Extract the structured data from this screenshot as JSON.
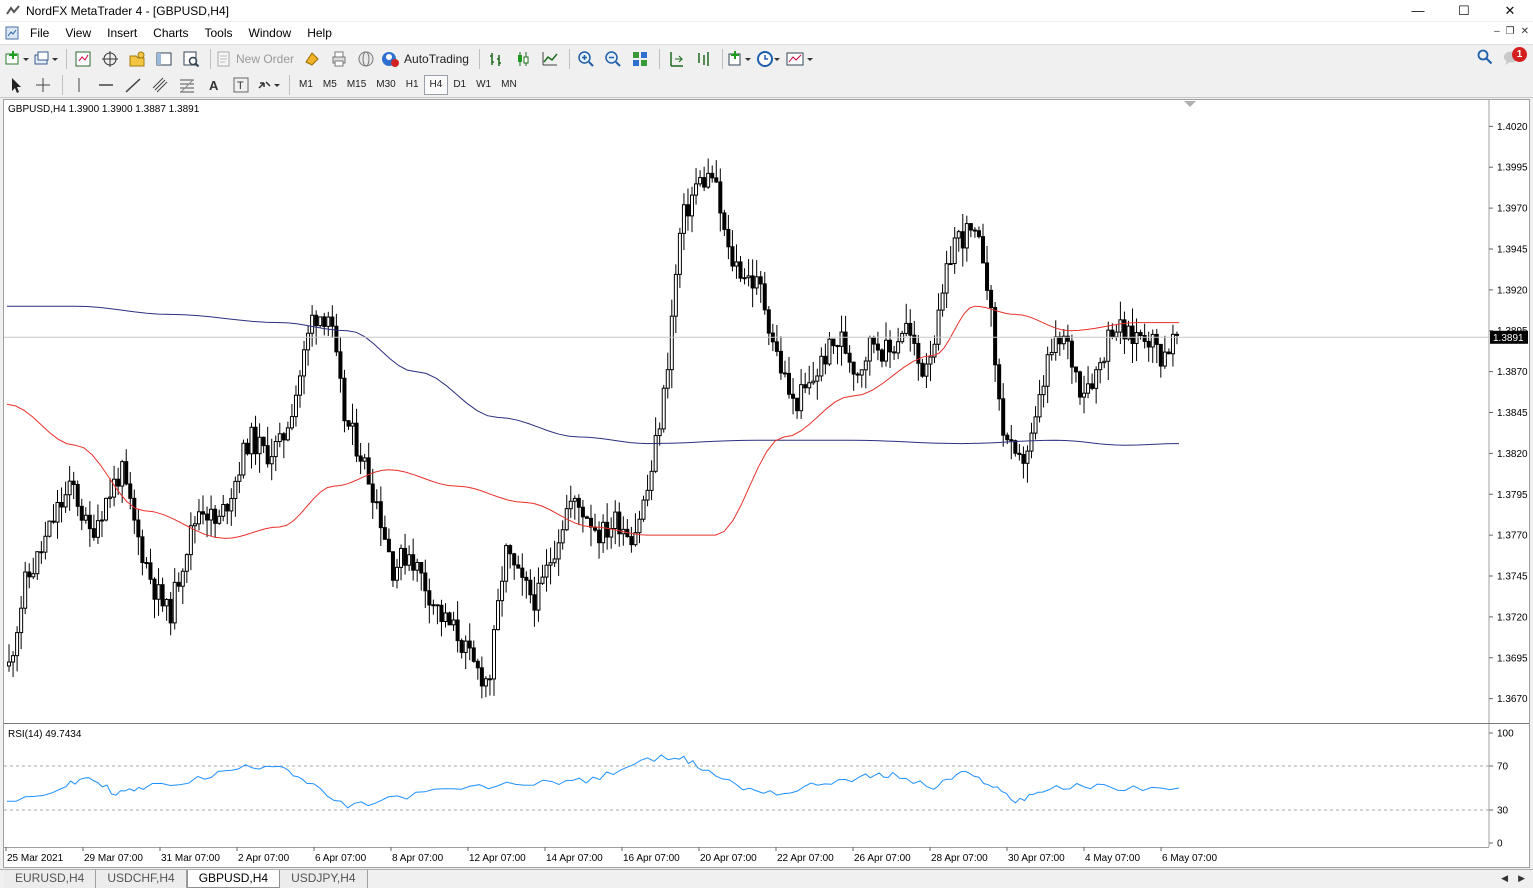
{
  "window": {
    "title": "NordFX MetaTrader 4 - [GBPUSD,H4]",
    "minimize": "—",
    "maximize": "☐",
    "close": "✕"
  },
  "menu": [
    "File",
    "View",
    "Insert",
    "Charts",
    "Tools",
    "Window",
    "Help"
  ],
  "mdi": {
    "minimize": "–",
    "restore": "❐",
    "close": "✕"
  },
  "toolbar": {
    "new_order": "New Order",
    "autotrading": "AutoTrading",
    "notification_count": "1"
  },
  "timeframes": [
    "M1",
    "M5",
    "M15",
    "M30",
    "H1",
    "H4",
    "D1",
    "W1",
    "MN"
  ],
  "active_timeframe": "H4",
  "chart": {
    "header": "GBPUSD,H4  1.3900 1.3900 1.3887 1.3891",
    "current_price": "1.3891",
    "rsi_label": "RSI(14) 49.7434",
    "colors": {
      "ma_fast": "#e8302a",
      "ma_slow": "#2b2f7e",
      "rsi": "#1e90ff",
      "candles": "#000000",
      "price_label_bg": "#000000"
    }
  },
  "chart_data": {
    "type": "candlestick",
    "symbol": "GBPUSD",
    "timeframe": "H4",
    "price_axis": {
      "ticks": [
        "1.4020",
        "1.3995",
        "1.3970",
        "1.3945",
        "1.3920",
        "1.3895",
        "1.3870",
        "1.3845",
        "1.3820",
        "1.3795",
        "1.3770",
        "1.3745",
        "1.3720",
        "1.3695",
        "1.3670"
      ],
      "ylim": [
        1.366,
        1.403
      ]
    },
    "rsi_axis": {
      "ticks": [
        "100",
        "70",
        "30",
        "0"
      ],
      "levels": [
        70,
        30
      ],
      "ylim": [
        0,
        100
      ]
    },
    "time_axis": [
      "25 Mar 2021",
      "29 Mar 07:00",
      "31 Mar 07:00",
      "2 Apr 07:00",
      "6 Apr 07:00",
      "8 Apr 07:00",
      "12 Apr 07:00",
      "14 Apr 07:00",
      "16 Apr 07:00",
      "20 Apr 07:00",
      "22 Apr 07:00",
      "26 Apr 07:00",
      "28 Apr 07:00",
      "30 Apr 07:00",
      "4 May 07:00",
      "6 May 07:00"
    ],
    "close_path": [
      1.369,
      1.374,
      1.376,
      1.3785,
      1.38,
      1.377,
      1.379,
      1.381,
      1.377,
      1.374,
      1.372,
      1.376,
      1.379,
      1.3775,
      1.38,
      1.383,
      1.382,
      1.3825,
      1.386,
      1.3905,
      1.3905,
      1.384,
      1.382,
      1.379,
      1.375,
      1.376,
      1.374,
      1.372,
      1.371,
      1.369,
      1.368,
      1.376,
      1.374,
      1.373,
      1.376,
      1.379,
      1.3785,
      1.377,
      1.378,
      1.377,
      1.38,
      1.386,
      1.396,
      1.3985,
      1.399,
      1.394,
      1.393,
      1.392,
      1.388,
      1.385,
      1.386,
      1.388,
      1.389,
      1.387,
      1.389,
      1.388,
      1.39,
      1.387,
      1.3895,
      1.395,
      1.3955,
      1.394,
      1.384,
      1.381,
      1.383,
      1.388,
      1.389,
      1.386,
      1.387,
      1.39,
      1.389,
      1.3895,
      1.388,
      1.3891
    ],
    "ma_fast": [
      [
        0,
        1.385
      ],
      [
        0.05,
        1.3825
      ],
      [
        0.1,
        1.3785
      ],
      [
        0.16,
        1.3768
      ],
      [
        0.2,
        1.3775
      ],
      [
        0.24,
        1.38
      ],
      [
        0.28,
        1.381
      ],
      [
        0.33,
        1.38
      ],
      [
        0.38,
        1.379
      ],
      [
        0.43,
        1.3775
      ],
      [
        0.47,
        1.377
      ],
      [
        0.52,
        1.377
      ],
      [
        0.57,
        1.383
      ],
      [
        0.62,
        1.3855
      ],
      [
        0.68,
        1.388
      ],
      [
        0.71,
        1.391
      ],
      [
        0.74,
        1.3905
      ],
      [
        0.78,
        1.3895
      ],
      [
        0.83,
        1.39
      ],
      [
        0.86,
        1.39
      ]
    ],
    "ma_slow": [
      [
        0,
        1.391
      ],
      [
        0.05,
        1.391
      ],
      [
        0.12,
        1.3905
      ],
      [
        0.2,
        1.39
      ],
      [
        0.25,
        1.3895
      ],
      [
        0.3,
        1.387
      ],
      [
        0.36,
        1.3842
      ],
      [
        0.42,
        1.383
      ],
      [
        0.47,
        1.3826
      ],
      [
        0.55,
        1.3828
      ],
      [
        0.62,
        1.3828
      ],
      [
        0.7,
        1.3826
      ],
      [
        0.77,
        1.3828
      ],
      [
        0.82,
        1.3825
      ],
      [
        0.86,
        1.3826
      ]
    ],
    "rsi": [
      [
        0,
        35
      ],
      [
        0.04,
        50
      ],
      [
        0.06,
        60
      ],
      [
        0.08,
        45
      ],
      [
        0.1,
        50
      ],
      [
        0.14,
        58
      ],
      [
        0.17,
        68
      ],
      [
        0.2,
        72
      ],
      [
        0.22,
        55
      ],
      [
        0.25,
        32
      ],
      [
        0.28,
        40
      ],
      [
        0.32,
        48
      ],
      [
        0.36,
        52
      ],
      [
        0.4,
        56
      ],
      [
        0.43,
        57
      ],
      [
        0.46,
        72
      ],
      [
        0.49,
        80
      ],
      [
        0.51,
        68
      ],
      [
        0.54,
        50
      ],
      [
        0.57,
        45
      ],
      [
        0.6,
        55
      ],
      [
        0.63,
        60
      ],
      [
        0.65,
        62
      ],
      [
        0.68,
        50
      ],
      [
        0.7,
        64
      ],
      [
        0.72,
        55
      ],
      [
        0.74,
        38
      ],
      [
        0.76,
        48
      ],
      [
        0.79,
        52
      ],
      [
        0.82,
        50
      ],
      [
        0.86,
        50
      ]
    ]
  }
}
